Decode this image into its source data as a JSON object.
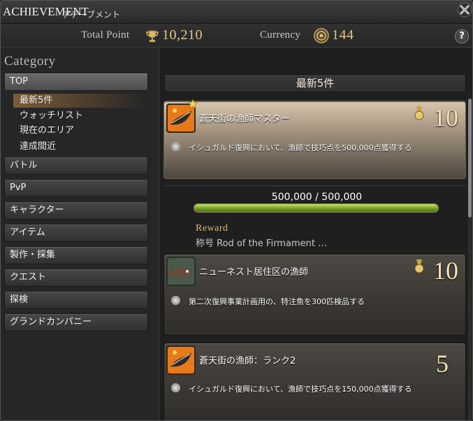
{
  "window": {
    "title_en": "ACHIEVEMENT",
    "title_jp": "アチーブメント"
  },
  "points": {
    "total_label": "Total Point",
    "total_value": "10,210",
    "currency_label": "Currency",
    "currency_value": "144",
    "help": "?"
  },
  "sidebar": {
    "title": "Category",
    "top_button": "TOP",
    "sub_items": [
      {
        "label": "最新5件",
        "selected": true
      },
      {
        "label": "ウォッチリスト",
        "selected": false
      },
      {
        "label": "現在のエリア",
        "selected": false
      },
      {
        "label": "達成間近",
        "selected": false
      }
    ],
    "categories": [
      "バトル",
      "PvP",
      "キャラクター",
      "アイテム",
      "製作・採集",
      "クエスト",
      "探検",
      "グランドカンパニー"
    ]
  },
  "main": {
    "header": "最新5件",
    "achievements": [
      {
        "title": "蒼天街の漁師マスター",
        "description": "イシュガルド復興において、漁師で技巧点を500,000点獲得する",
        "points": "10"
      },
      {
        "title": "ニューネスト居住区の漁師",
        "description": "第二次復興事業計画用の、特注魚を300匹検品する",
        "points": "10"
      },
      {
        "title": "蒼天街の漁師：ランク2",
        "description": "イシュガルド復興において、漁師で技巧点を150,000点獲得する",
        "points": "5"
      }
    ],
    "progress": {
      "text": "500,000 / 500,000",
      "fraction": 1.0
    },
    "reward": {
      "label": "Reward",
      "value": "称号 Rod of the Firmament …"
    }
  },
  "colors": {
    "accent_gold": "#e3c98a",
    "progress_green": "#6e9a1e",
    "reward_gold": "#d9b87a"
  }
}
